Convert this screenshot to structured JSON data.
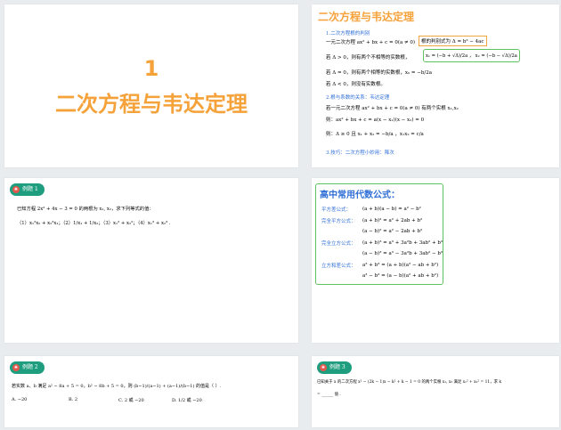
{
  "slides": {
    "s1": {
      "number": "1",
      "title": "二次方程与韦达定理"
    },
    "s2": {
      "title": "二次方程与韦达定理",
      "sec1": "1.二次方程根的判别",
      "l1a": "一元二次方程 ax² + bx + c = 0(a ≠ 0)",
      "l1b": "根的判别式为 Δ = b² − 4ac",
      "l2a": "若 Δ > 0，则有两个不相等的实数根，",
      "l2b": "x₁ = (−b + √Δ)/2a ， x₂ = (−b − √Δ)/2a",
      "l3": "若 Δ = 0，则有两个相等的实数根，x₀ = −b/2a",
      "l4": "若 Δ < 0，则没有实数根。",
      "sec2": "2.根与系数的关系：韦达定理",
      "l5": "若一元二次方程 ax² + bx + c = 0(a ≠ 0) 有两个实根 x₁,x₂",
      "l6": "则：ax² + bx + c = a(x − x₁)(x − x₂) = 0",
      "l7": "则：Δ ≥ 0 且 x₁ + x₂ = −b/a ，x₁x₂ = c/a",
      "sec3": "3.技巧：二次方程小妙用：降次"
    },
    "s3": {
      "badge": "例题 1",
      "q1": "已知方程 2x² + 4x − 3 = 0 的两根为 x₁, x₂，求下列等式的值：",
      "q2": "（1）x₁²x₂ + x₂²x₁；（2）1/x₁ + 1/x₂；（3）x₁² + x₂²；（4）x₁³ + x₂³ ."
    },
    "s4": {
      "title": "高中常用代数公式：",
      "rows": [
        {
          "label": "平方差公式：",
          "f": "(a + b)(a − b) = a² − b²"
        },
        {
          "label": "完全平方公式：",
          "f": "(a + b)² = a² + 2ab + b²"
        },
        {
          "label": "",
          "f": "(a − b)² = a² − 2ab + b²"
        },
        {
          "label": "完全立方公式：",
          "f": "(a + b)³ = a³ + 3a²b + 3ab² + b³"
        },
        {
          "label": "",
          "f": "(a − b)³ = a³ − 3a²b + 3ab² − b³"
        },
        {
          "label": "立方和差公式：",
          "f": "a³ + b³ = (a + b)(a² − ab + b²)"
        },
        {
          "label": "",
          "f": "a³ − b³ = (a − b)(a² + ab + b²)"
        }
      ]
    },
    "s5": {
      "badge": "例题 2",
      "q": "若实数 a、b 满足 a² − 8a + 5 = 0，b² − 8b + 5 = 0，则 (b−1)/(a−1) + (a−1)/(b−1) 的值是（ ）.",
      "opts": [
        "A. −20",
        "B. 2",
        "C. 2 或 −20",
        "D. 1/2 或 −20"
      ]
    },
    "s6": {
      "badge": "例题 3",
      "q": "已知关于 x 的二次方程 x² − (2k − 1)x − k² + k − 1 = 0 的两个实根 x₁, x₂ 满足 x₁² + x₂² = 11，求 k",
      "q2": "= ______ 值 ."
    }
  }
}
